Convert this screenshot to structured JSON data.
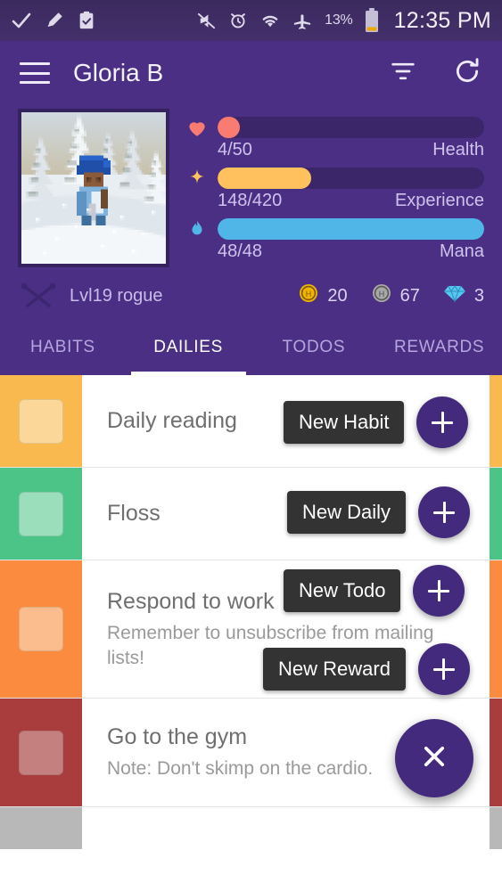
{
  "status_bar": {
    "left_icons": [
      "check-icon",
      "highlighter-icon",
      "clipboard-check-icon"
    ],
    "right_icons": [
      "mute-icon",
      "alarm-icon",
      "wifi-icon",
      "airplane-mode-icon",
      "battery-icon"
    ],
    "battery_percent": "13%",
    "time": "12:35 PM"
  },
  "appbar": {
    "title": "Gloria B",
    "menu_icon": "hamburger-icon",
    "filter_icon": "filter-icon",
    "refresh_icon": "refresh-icon"
  },
  "profile": {
    "avatar_alt": "pixel-art avatar in snowy forest",
    "bars": [
      {
        "icon": "heart-icon",
        "value": "4/50",
        "label": "Health",
        "current": 4,
        "max": 50,
        "color": "#fa7b72"
      },
      {
        "icon": "star-icon",
        "value": "148/420",
        "label": "Experience",
        "current": 148,
        "max": 420,
        "color": "#ffc15e"
      },
      {
        "icon": "flame-icon",
        "value": "48/48",
        "label": "Mana",
        "current": 48,
        "max": 48,
        "color": "#50b6e8"
      }
    ],
    "class_icon": "crossed-swords-icon",
    "level_class": "Lvl19 rogue",
    "currencies": [
      {
        "icon": "gold-coin-icon",
        "amount": "20",
        "color": "#f0b400"
      },
      {
        "icon": "silver-coin-icon",
        "amount": "67",
        "color": "#9a9a9a"
      },
      {
        "icon": "gem-icon",
        "amount": "3",
        "color": "#57c6f0"
      }
    ]
  },
  "tabs": [
    {
      "label": "HABITS",
      "active": false
    },
    {
      "label": "DAILIES",
      "active": true
    },
    {
      "label": "TODOS",
      "active": false
    },
    {
      "label": "REWARDS",
      "active": false
    }
  ],
  "tasks": [
    {
      "title": "Daily reading",
      "note": "",
      "color": "#f9b94e",
      "checkbox_color": "#fbd79a"
    },
    {
      "title": "Floss",
      "note": "",
      "color": "#4cc487",
      "checkbox_color": "#9adebb"
    },
    {
      "title": "Respond to work",
      "note": "Remember to unsubscribe from mailing lists!",
      "color": "#fb8c3f",
      "checkbox_color": "#fcbd8e"
    },
    {
      "title": "Go to the gym",
      "note": "Note: Don't skimp on the cardio.",
      "color": "#a93c3c",
      "checkbox_color": "#c4807f"
    },
    {
      "title": "",
      "note": "",
      "color": "#b8b8b8",
      "checkbox_color": "#d4d4d4"
    }
  ],
  "fab": {
    "main_icon": "close-icon",
    "main_color": "#432a7c",
    "actions": [
      {
        "label": "New Habit",
        "icon": "plus-icon"
      },
      {
        "label": "New Daily",
        "icon": "plus-icon"
      },
      {
        "label": "New Todo",
        "icon": "plus-icon"
      },
      {
        "label": "New Reward",
        "icon": "plus-icon"
      }
    ]
  }
}
